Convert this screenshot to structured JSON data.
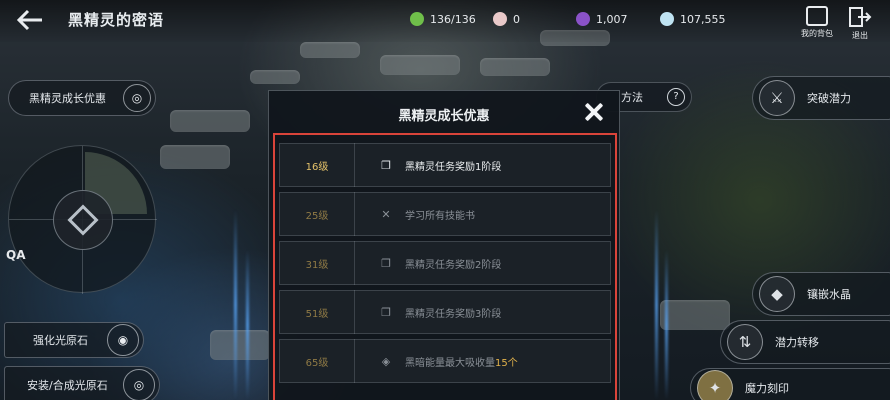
{
  "header": {
    "title": "黑精灵的密语",
    "resources": [
      {
        "icon": "stamina-icon",
        "value": "136/136",
        "color": "#6fbf4a"
      },
      {
        "icon": "pearl-icon",
        "value": "0",
        "color": "#e9c9c9"
      },
      {
        "icon": "purple-gem-icon",
        "value": "1,007",
        "color": "#8a52c8"
      },
      {
        "icon": "diamond-icon",
        "value": "107,555",
        "color": "#bfe3f2"
      }
    ],
    "bag_label": "我的背包",
    "exit_label": "退出"
  },
  "left": {
    "growth_button": "黑精灵成长优惠",
    "qa_label": "QA",
    "enhance_label": "强化光原石",
    "install_label": "安装/合成光原石"
  },
  "right": {
    "breakthrough_label": "突破潜力",
    "method_label": "方法",
    "inlay_label": "镶嵌水晶",
    "transfer_label": "潜力转移",
    "imprint_label": "魔力刻印"
  },
  "modal": {
    "title": "黑精灵成长优惠",
    "rows": [
      {
        "level": "16级",
        "icon": "quest-scroll-icon",
        "text": "黑精灵任务奖励1阶段",
        "highlight": "",
        "state": "active"
      },
      {
        "level": "25级",
        "icon": "crossed-swords-icon",
        "text": "学习所有技能书",
        "highlight": "",
        "state": "locked"
      },
      {
        "level": "31级",
        "icon": "quest-scroll-icon",
        "text": "黑精灵任务奖励2阶段",
        "highlight": "",
        "state": "locked"
      },
      {
        "level": "51级",
        "icon": "quest-scroll-icon",
        "text": "黑精灵任务奖励3阶段",
        "highlight": "",
        "state": "locked"
      },
      {
        "level": "65级",
        "icon": "diamond-rune-icon",
        "text": "黑暗能量最大吸收量",
        "highlight": "15个",
        "state": "locked"
      }
    ]
  }
}
